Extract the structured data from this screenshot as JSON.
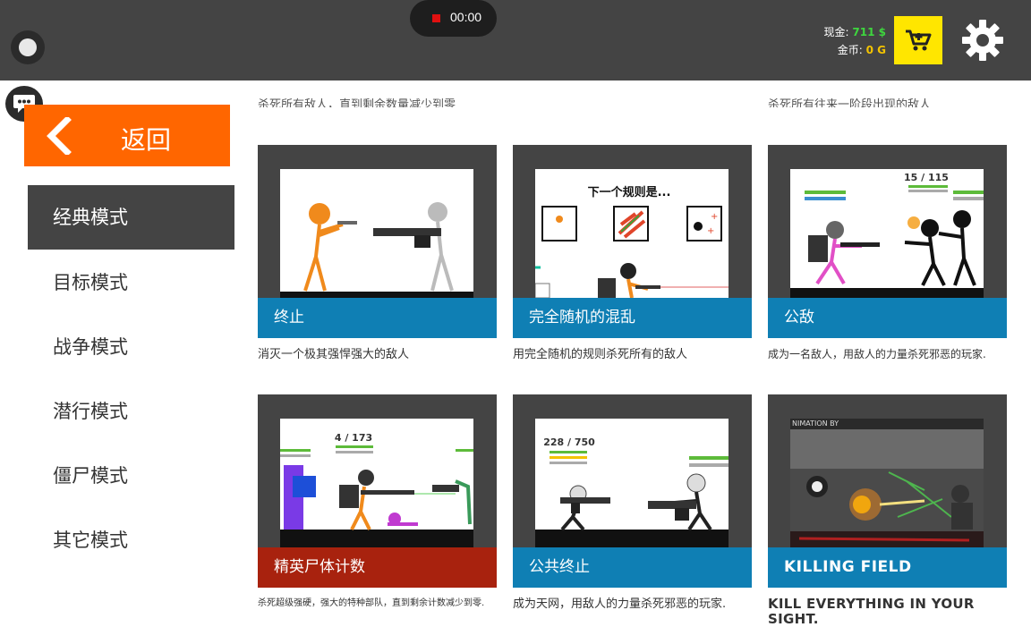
{
  "recording": {
    "time": "00:00"
  },
  "currency": {
    "cash_label": "现金:",
    "cash_value": "711 $",
    "gold_label": "金币:",
    "gold_value": "0 G"
  },
  "back_label": "返回",
  "menu": [
    {
      "label": "经典模式",
      "active": true
    },
    {
      "label": "目标模式",
      "active": false
    },
    {
      "label": "战争模式",
      "active": false
    },
    {
      "label": "潜行模式",
      "active": false
    },
    {
      "label": "僵尸模式",
      "active": false
    },
    {
      "label": "其它模式",
      "active": false
    }
  ],
  "partial_descriptions": [
    "杀死所有敌人，直到剩余数量减少到零",
    "杀死所有往来一阶段出现的敌人"
  ],
  "cards": [
    {
      "title": "终止",
      "description": "消灭一个极其强悍强大的敌人",
      "caption_color": "#0f7fb4",
      "scene_text": ""
    },
    {
      "title": "完全随机的混乱",
      "description": "用完全随机的规则杀死所有的敌人",
      "caption_color": "#0f7fb4",
      "scene_text": "下一个规则是..."
    },
    {
      "title": "公敌",
      "description": "成为一名敌人，用敌人的力量杀死邪恶的玩家.",
      "caption_color": "#0f7fb4",
      "scene_text": "15 / 115"
    },
    {
      "title": "精英尸体计数",
      "description": "杀死超级强硬，强大的特种部队，直到剩余计数减少到零.",
      "caption_color": "#a8220e",
      "scene_text": "4 / 173"
    },
    {
      "title": "公共终止",
      "description": "成为天网，用敌人的力量杀死邪恶的玩家.",
      "caption_color": "#0f7fb4",
      "scene_text": "228 / 750"
    },
    {
      "title": "KILLING FIELD",
      "description": "KILL EVERYTHING IN YOUR SIGHT.",
      "caption_color": "#0f7fb4",
      "scene_text": "NIMATION BY"
    }
  ],
  "colors": {
    "topbar": "#444444",
    "back_button": "#ff6600",
    "shop_button": "#ffe600",
    "cash": "#3ed63e",
    "gold": "#f3c300"
  },
  "icons": [
    "record-icon",
    "chat-icon",
    "chevron-left-icon",
    "cart-icon",
    "gear-icon"
  ]
}
